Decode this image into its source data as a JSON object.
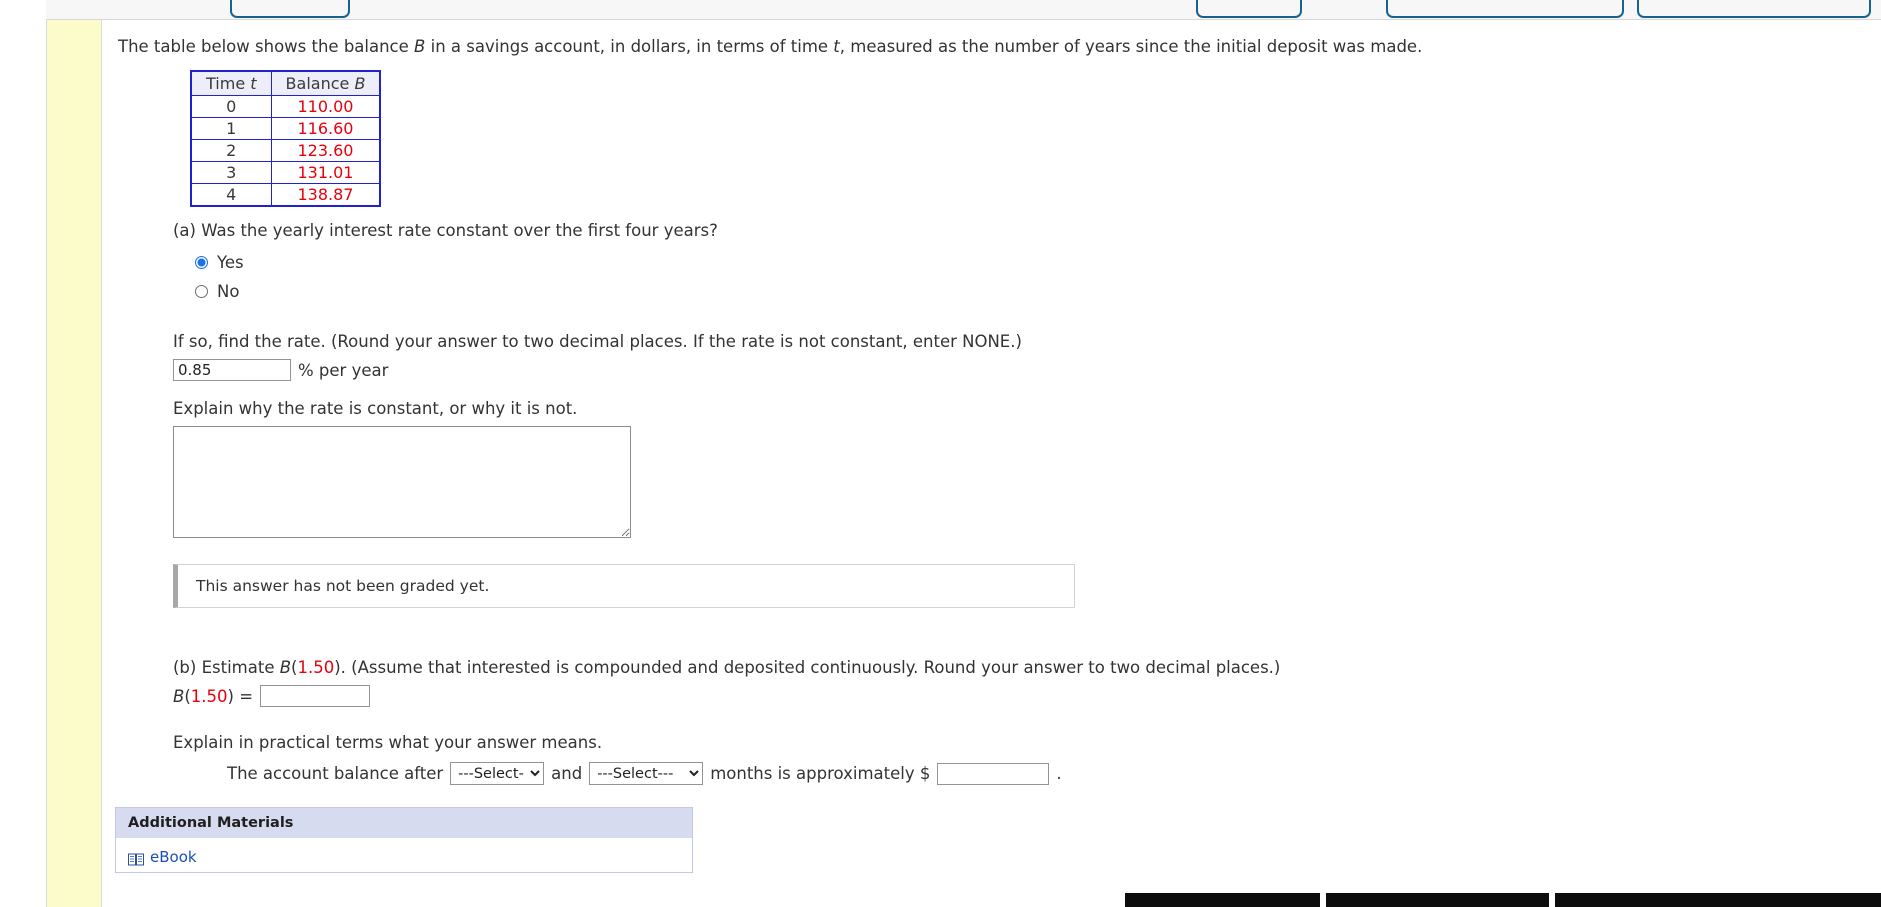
{
  "intro": {
    "before_b": "The table below shows the balance ",
    "var_b": "B",
    "middle": " in a savings account, in dollars, in terms of time ",
    "var_t": "t",
    "after_t": ", measured as the number of years since the initial deposit was made."
  },
  "table": {
    "headers": [
      "Time t",
      "Balance B"
    ],
    "header_time_label": "Time ",
    "header_time_var": "t",
    "header_balance_label": "Balance ",
    "header_balance_var": "B",
    "rows": [
      {
        "time": "0",
        "balance": "110.00"
      },
      {
        "time": "1",
        "balance": "116.60"
      },
      {
        "time": "2",
        "balance": "123.60"
      },
      {
        "time": "3",
        "balance": "131.01"
      },
      {
        "time": "4",
        "balance": "138.87"
      }
    ]
  },
  "part_a": {
    "question": "(a) Was the yearly interest rate constant over the first four years?",
    "options": [
      {
        "label": "Yes",
        "selected": true
      },
      {
        "label": "No",
        "selected": false
      }
    ],
    "rate_prompt": "If so, find the rate. (Round your answer to two decimal places. If the rate is not constant, enter NONE.)",
    "rate_value": "0.85",
    "rate_unit": "% per year",
    "explain_prompt": "Explain why the rate is constant, or why it is not.",
    "explain_value": "",
    "ungraded_notice": "This answer has not been graded yet."
  },
  "part_b": {
    "question_prefix": "(b) Estimate ",
    "question_func": "B",
    "question_arg": "1.50",
    "question_suffix": ". (Assume that interested is compounded and deposited continuously. Round your answer to two decimal places.)",
    "answer_label_func": "B",
    "answer_label_arg": "1.50",
    "answer_label_equals": " = ",
    "answer_value": "",
    "practical_prompt": "Explain in practical terms what your answer means.",
    "sentence_start": "The account balance after",
    "select_placeholder": "---Select---",
    "sentence_and": "and",
    "sentence_middle": "months is approximately $",
    "sentence_end": ".",
    "dropdown_1_value": "---Select---",
    "dropdown_2_value": "---Select---",
    "dollar_value": ""
  },
  "materials": {
    "title": "Additional Materials",
    "items": [
      {
        "label": "eBook",
        "icon": "book-icon"
      }
    ]
  },
  "colors": {
    "balance_red": "#e8000b",
    "table_border_blue": "#2222cc",
    "table_header_bg": "#eeeefa",
    "rail_yellow": "#fcfccb",
    "materials_header_bg": "#d7dbf0",
    "radio_blue": "#1a73e8",
    "link_blue": "#1a4fbb"
  }
}
